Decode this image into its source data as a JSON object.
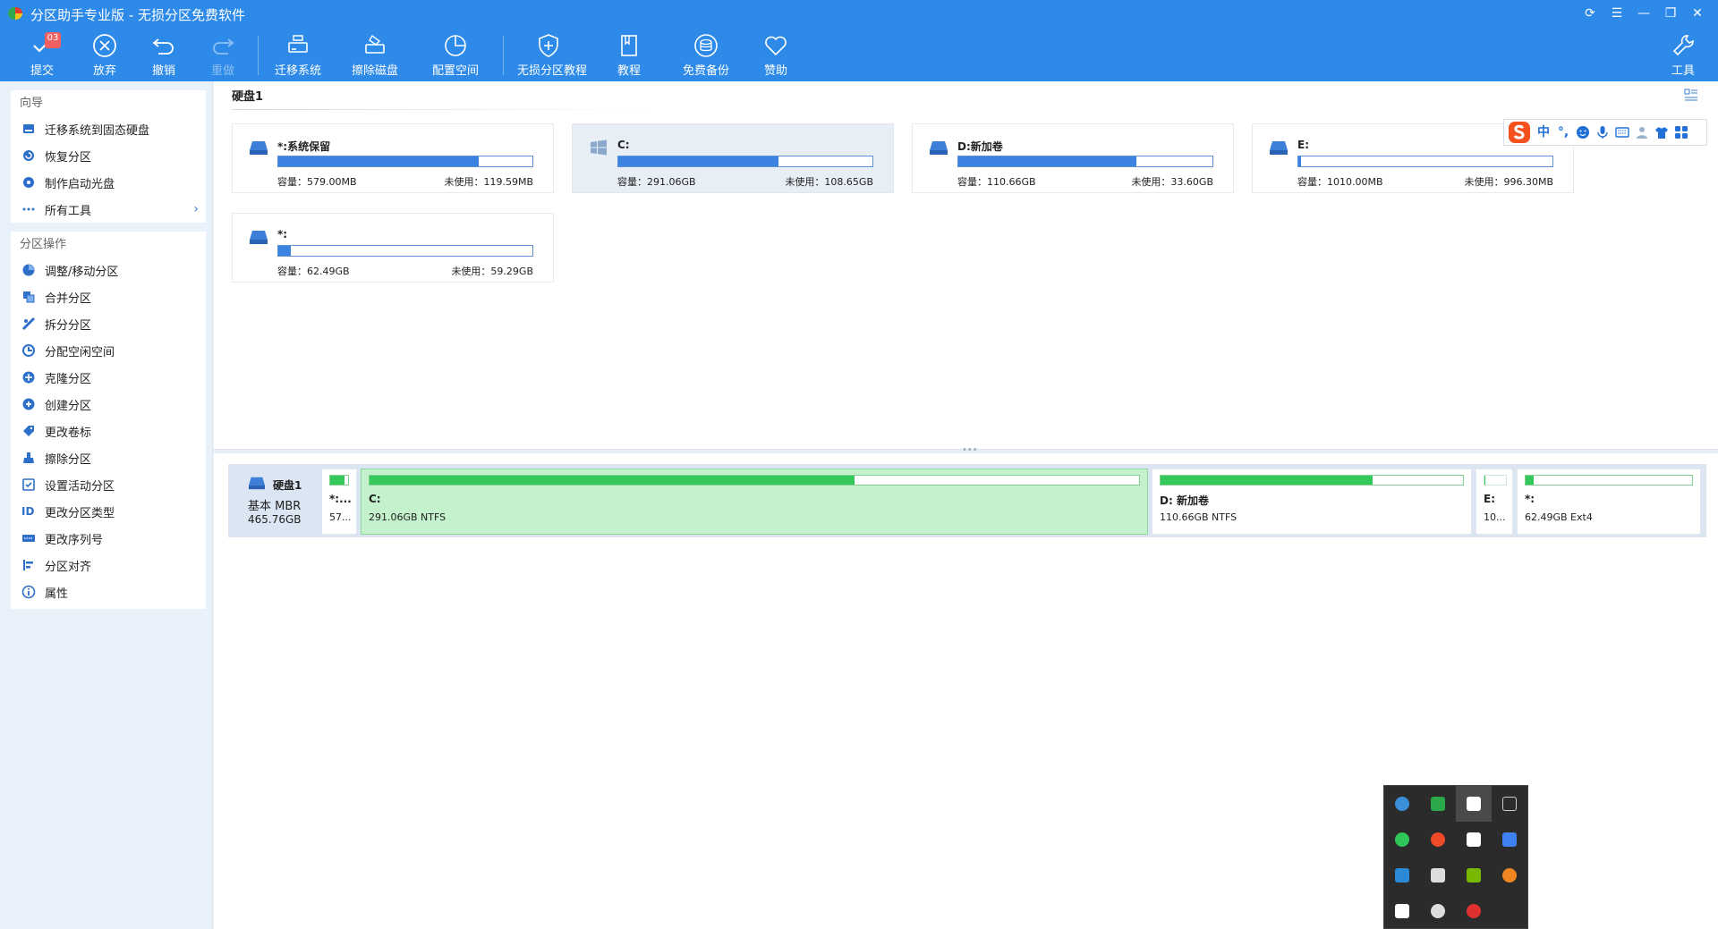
{
  "window": {
    "title": "分区助手专业版 - 无损分区免费软件",
    "controls": [
      "refresh-icon",
      "menu-icon",
      "minimize-icon",
      "restore-icon",
      "close-icon"
    ]
  },
  "toolbar": {
    "pending_count": "03",
    "items": [
      {
        "label": "提交",
        "icon": "check-icon"
      },
      {
        "label": "放弃",
        "icon": "cancel-circle-icon"
      },
      {
        "label": "撤销",
        "icon": "undo-icon"
      },
      {
        "label": "重做",
        "icon": "redo-icon",
        "disabled": true
      },
      {
        "label": "迁移系统",
        "icon": "migrate-disk-icon"
      },
      {
        "label": "擦除磁盘",
        "icon": "wipe-disk-icon"
      },
      {
        "label": "配置空间",
        "icon": "pie-icon"
      },
      {
        "label": "无损分区教程",
        "icon": "shield-icon"
      },
      {
        "label": "教程",
        "icon": "book-icon"
      },
      {
        "label": "免费备份",
        "icon": "backup-icon"
      },
      {
        "label": "赞助",
        "icon": "heart-icon"
      },
      {
        "label": "工具",
        "icon": "wrench-icon"
      }
    ]
  },
  "sidebar": {
    "wizard": {
      "title": "向导",
      "items": [
        {
          "label": "迁移系统到固态硬盘",
          "icon": "ssd-icon"
        },
        {
          "label": "恢复分区",
          "icon": "recover-icon"
        },
        {
          "label": "制作启动光盘",
          "icon": "boot-disc-icon"
        },
        {
          "label": "所有工具",
          "icon": "more-icon",
          "arrow": "›"
        }
      ]
    },
    "operations": {
      "title": "分区操作",
      "items": [
        {
          "label": "调整/移动分区",
          "icon": "resize-icon"
        },
        {
          "label": "合并分区",
          "icon": "merge-icon"
        },
        {
          "label": "拆分分区",
          "icon": "split-icon"
        },
        {
          "label": "分配空闲空间",
          "icon": "allocate-icon"
        },
        {
          "label": "克隆分区",
          "icon": "clone-icon"
        },
        {
          "label": "创建分区",
          "icon": "create-icon"
        },
        {
          "label": "更改卷标",
          "icon": "label-icon"
        },
        {
          "label": "擦除分区",
          "icon": "wipe-icon"
        },
        {
          "label": "设置活动分区",
          "icon": "active-icon"
        },
        {
          "label": "更改分区类型",
          "icon": "id-icon",
          "text_icon": "ID"
        },
        {
          "label": "更改序列号",
          "icon": "serial-icon"
        },
        {
          "label": "分区对齐",
          "icon": "align-icon"
        },
        {
          "label": "属性",
          "icon": "info-icon"
        }
      ]
    }
  },
  "main": {
    "disk_title": "硬盘1",
    "partitions": [
      {
        "name": "*:系统保留",
        "capacity": "容量：579.00MB",
        "free": "未使用：119.59MB",
        "used_fraction": 0.79,
        "icon": "drive-icon"
      },
      {
        "name": "C:",
        "capacity": "容量：291.06GB",
        "free": "未使用：108.65GB",
        "used_fraction": 0.63,
        "icon": "windows-icon",
        "selected": true
      },
      {
        "name": "D:新加卷",
        "capacity": "容量：110.66GB",
        "free": "未使用：33.60GB",
        "used_fraction": 0.7,
        "icon": "drive-icon"
      },
      {
        "name": "E:",
        "capacity": "容量：1010.00MB",
        "free": "未使用：996.30MB",
        "used_fraction": 0.01,
        "icon": "drive-icon"
      },
      {
        "name": "*:",
        "capacity": "容量：62.49GB",
        "free": "未使用：59.29GB",
        "used_fraction": 0.05,
        "icon": "drive-icon"
      }
    ]
  },
  "diskmap": {
    "name": "硬盘1",
    "type": "基本 MBR",
    "size": "465.76GB",
    "segments": [
      {
        "name": "*:...",
        "info": "57...",
        "used_fraction": 0.79
      },
      {
        "name": "C:",
        "info": "291.06GB NTFS",
        "used_fraction": 0.63,
        "selected": true
      },
      {
        "name": "D: 新加卷",
        "info": "110.66GB NTFS",
        "used_fraction": 0.7
      },
      {
        "name": "E:",
        "info": "10...",
        "used_fraction": 0.01
      },
      {
        "name": "*:",
        "info": "62.49GB Ext4",
        "used_fraction": 0.05
      }
    ]
  },
  "ime": {
    "items": [
      "sogou-logo-icon",
      "中",
      "°,",
      "emoji-icon",
      "mic-icon",
      "keyboard-icon",
      "user-icon",
      "shirt-icon",
      "grid-icon"
    ]
  },
  "tray": {
    "icons": [
      "16-badge-icon",
      "app-icon",
      "grid-icon",
      "copy-icon",
      "wechat-icon",
      "red-app-icon",
      "shield-icon",
      "blue-app-icon",
      "windows-icon",
      "screenshot-icon",
      "nvidia-icon",
      "search-icon",
      "pen-icon",
      "satellite-icon",
      "red-logo-icon"
    ],
    "colors": [
      "#3a8fd8",
      "#2aa84a",
      "#ffffff",
      "#cccccc",
      "#2fc65a",
      "#f04a2a",
      "#ffffff",
      "#3d82f0",
      "#2a8ad8",
      "#dddddd",
      "#76b900",
      "#f0861f",
      "#ffffff",
      "#dddddd",
      "#e03030"
    ]
  },
  "colors": {
    "toolbar": "#2d8ae8",
    "partition_bar": "#3c82e0",
    "map_bar": "#34c759",
    "selected_segment": "#c3f2cc"
  }
}
